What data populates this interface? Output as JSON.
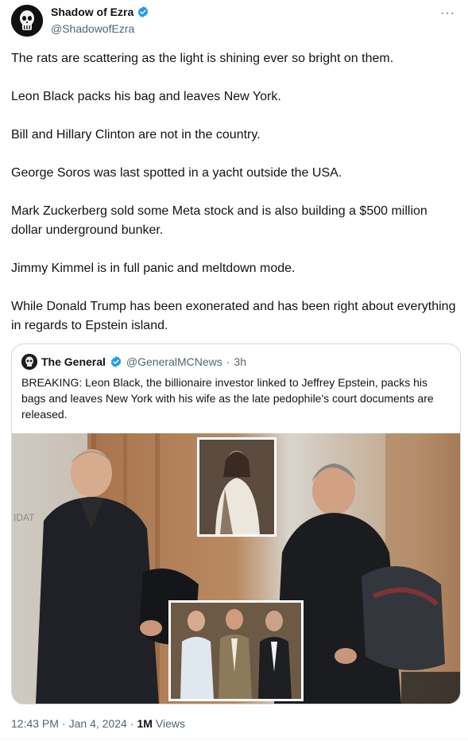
{
  "author": {
    "name": "Shadow of Ezra",
    "handle": "@ShadowofEzra",
    "verified_color": "#1d9bf0"
  },
  "more_label": "···",
  "tweet_paragraphs": [
    "The rats are scattering as the light is shining ever so bright on them.",
    "Leon Black packs his bag and leaves New York.",
    "Bill and Hillary Clinton are not in the country.",
    "George Soros was last spotted in a yacht outside the USA.",
    "Mark Zuckerberg sold some Meta stock and is also building a $500 million dollar underground bunker.",
    "Jimmy Kimmel is in full panic and meltdown mode.",
    "While Donald Trump has been exonerated and has been right about everything in regards to Epstein island."
  ],
  "quoted": {
    "name": "The General",
    "handle": "@GeneralMCNews",
    "separator": "·",
    "time": "3h",
    "text": "BREAKING: Leon Black, the billionaire investor linked to Jeffrey Epstein, packs his bags and leaves New York with his wife as the late pedophile's court documents are released.",
    "image_sign_text": "IDAT"
  },
  "meta": {
    "time": "12:43 PM",
    "separator": "·",
    "date": "Jan 4, 2024",
    "separator2": "·",
    "views_count": "1M",
    "views_label": "Views"
  },
  "colors": {
    "text": "#0f1419",
    "secondary": "#536471",
    "border": "#cfd9de"
  }
}
